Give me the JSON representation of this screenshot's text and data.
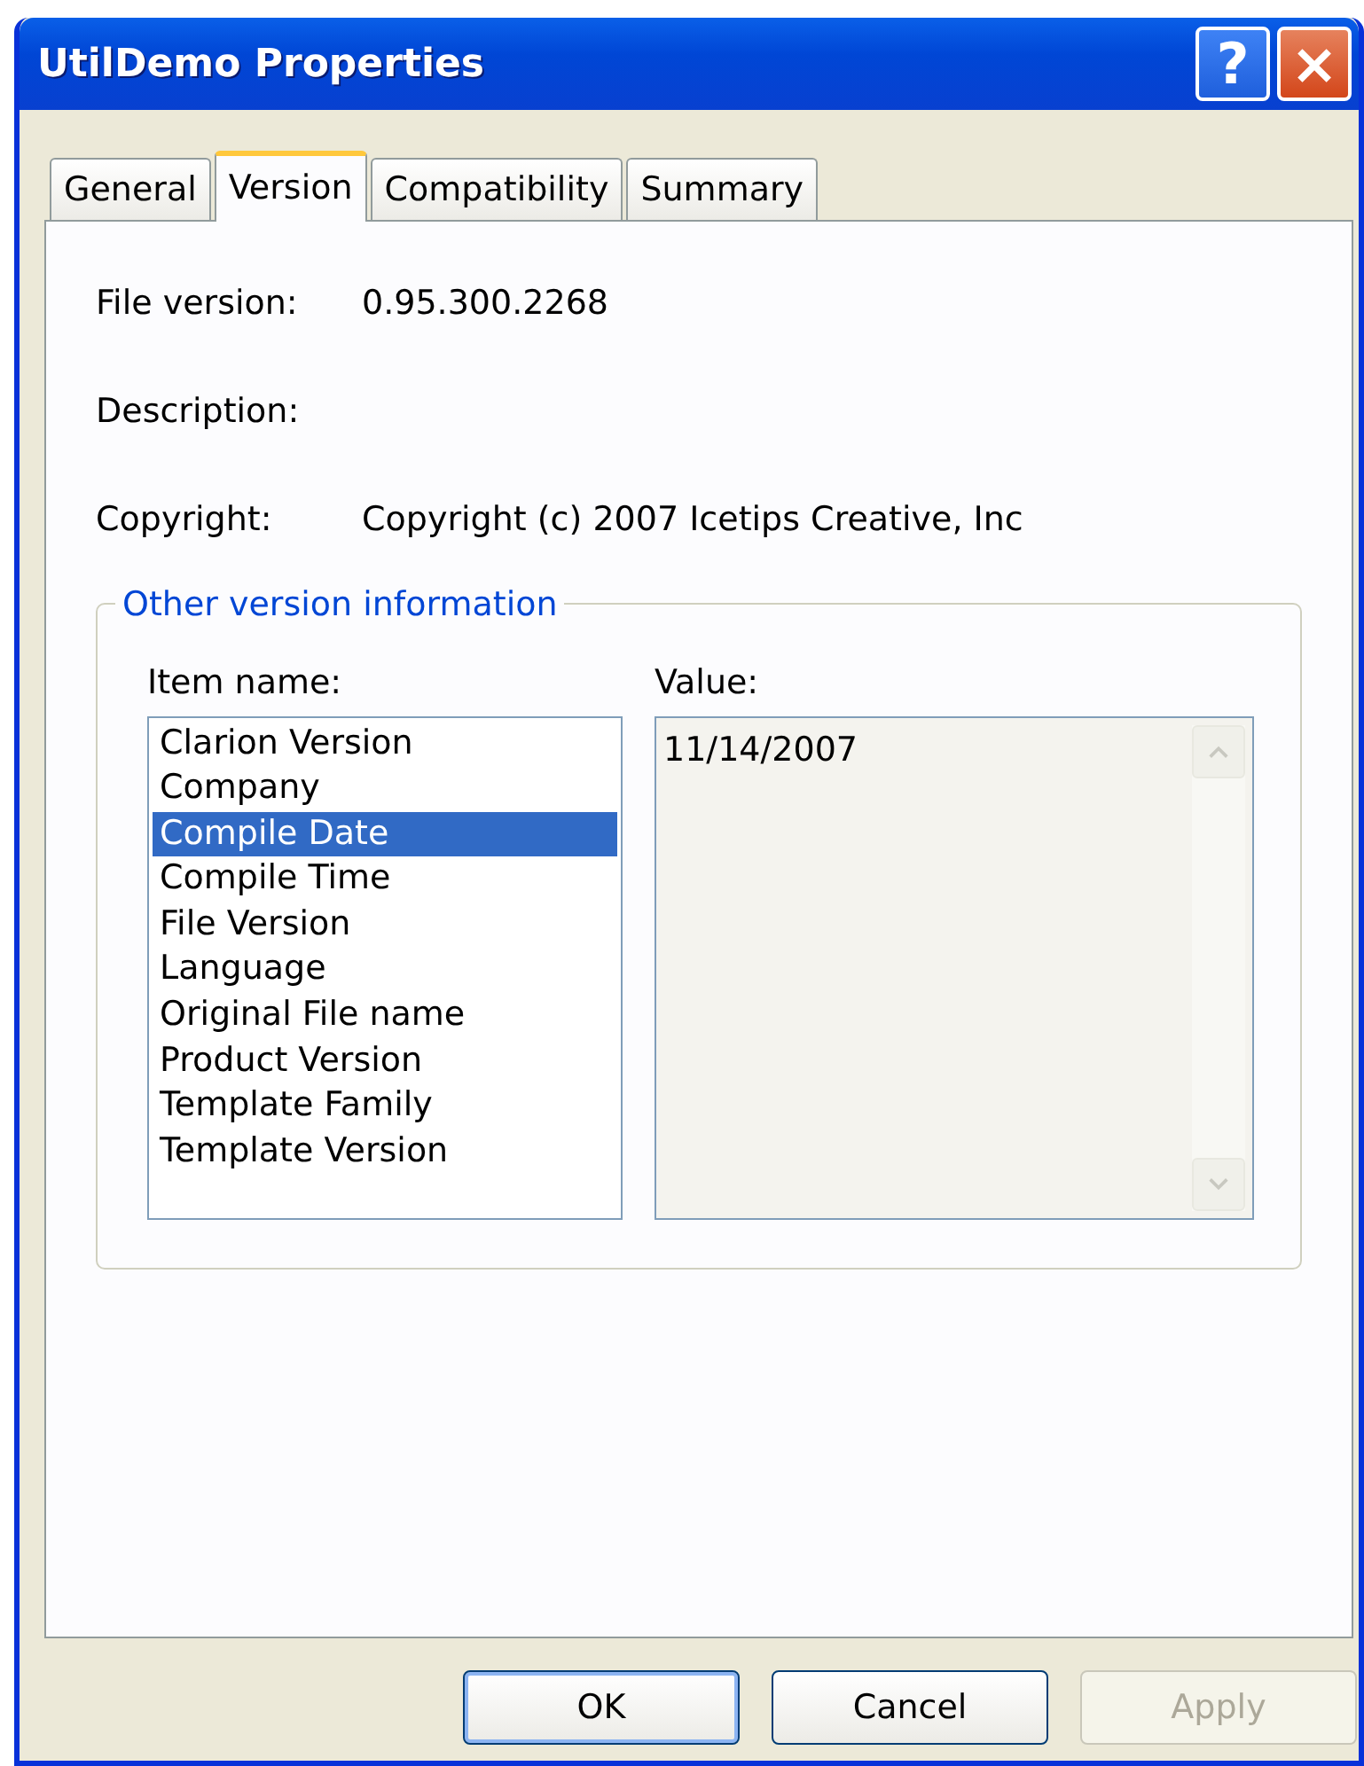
{
  "window": {
    "title": "UtilDemo Properties"
  },
  "title_buttons": [
    {
      "kind": "help",
      "label": "?"
    },
    {
      "kind": "close",
      "label": "×"
    }
  ],
  "tabs": [
    {
      "label": "General",
      "selected": false
    },
    {
      "label": "Version",
      "selected": true
    },
    {
      "label": "Compatibility",
      "selected": false
    },
    {
      "label": "Summary",
      "selected": false
    }
  ],
  "fields": [
    {
      "label": "File version:",
      "value": "0.95.300.2268"
    },
    {
      "label": "Description:"
    },
    {
      "label": "Copyright:",
      "value": "Copyright (c) 2007 Icetips Creative, Inc"
    }
  ],
  "group": {
    "title": "Other version information",
    "item_label": "Item name:",
    "value_label": "Value:",
    "items": [
      {
        "label": "Clarion Version",
        "selected": false
      },
      {
        "label": "Company",
        "selected": false
      },
      {
        "label": "Compile Date",
        "selected": true
      },
      {
        "label": "Compile Time",
        "selected": false
      },
      {
        "label": "File Version",
        "selected": false
      },
      {
        "label": "Language",
        "selected": false
      },
      {
        "label": "Original File name",
        "selected": false
      },
      {
        "label": "Product Version",
        "selected": false
      },
      {
        "label": "Template Family",
        "selected": false
      },
      {
        "label": "Template Version",
        "selected": false
      }
    ],
    "value": "11/14/2007"
  },
  "buttons": [
    {
      "label": "OK",
      "default": true,
      "disabled": false
    },
    {
      "label": "Cancel",
      "default": false,
      "disabled": false
    },
    {
      "label": "Apply",
      "default": false,
      "disabled": true
    }
  ]
}
